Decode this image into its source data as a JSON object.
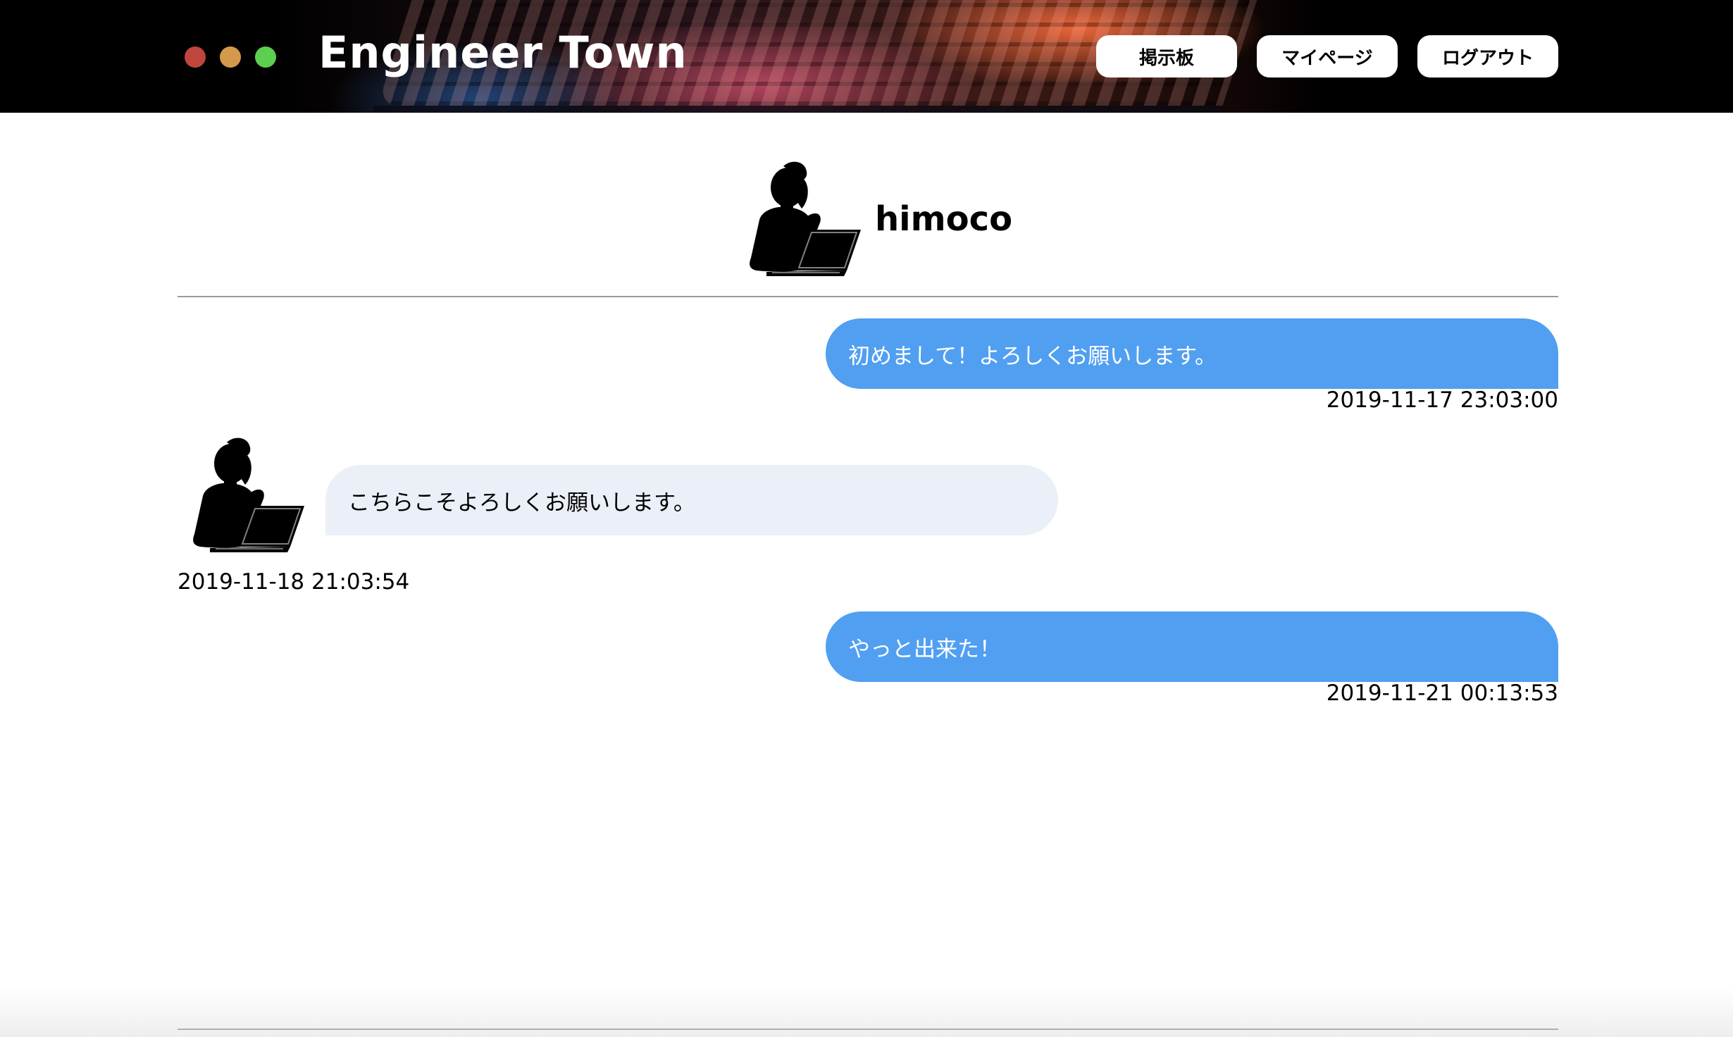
{
  "header": {
    "brand": "Engineer Town",
    "nav": {
      "board_label": "掲示板",
      "mypage_label": "マイページ",
      "logout_label": "ログアウト"
    },
    "window_controls": [
      "close",
      "minimize",
      "maximize"
    ],
    "colors": {
      "close": "#c0453f",
      "minimize": "#d49a4b",
      "maximize": "#5ccf4f"
    }
  },
  "profile": {
    "name": "himoco",
    "avatar_icon": "woman-with-laptop-icon"
  },
  "messages": [
    {
      "direction": "sent",
      "text": "初めまして！よろしくお願いします。",
      "timestamp": "2019-11-17 23:03:00"
    },
    {
      "direction": "received",
      "text": "こちらこそよろしくお願いします。",
      "timestamp": "2019-11-18 21:03:54"
    },
    {
      "direction": "sent",
      "text": "やっと出来た！",
      "timestamp": "2019-11-21 00:13:53"
    }
  ],
  "colors": {
    "sent_bubble": "#519ff1",
    "received_bubble": "#ebf0f8",
    "divider": "#9a9a9a"
  }
}
